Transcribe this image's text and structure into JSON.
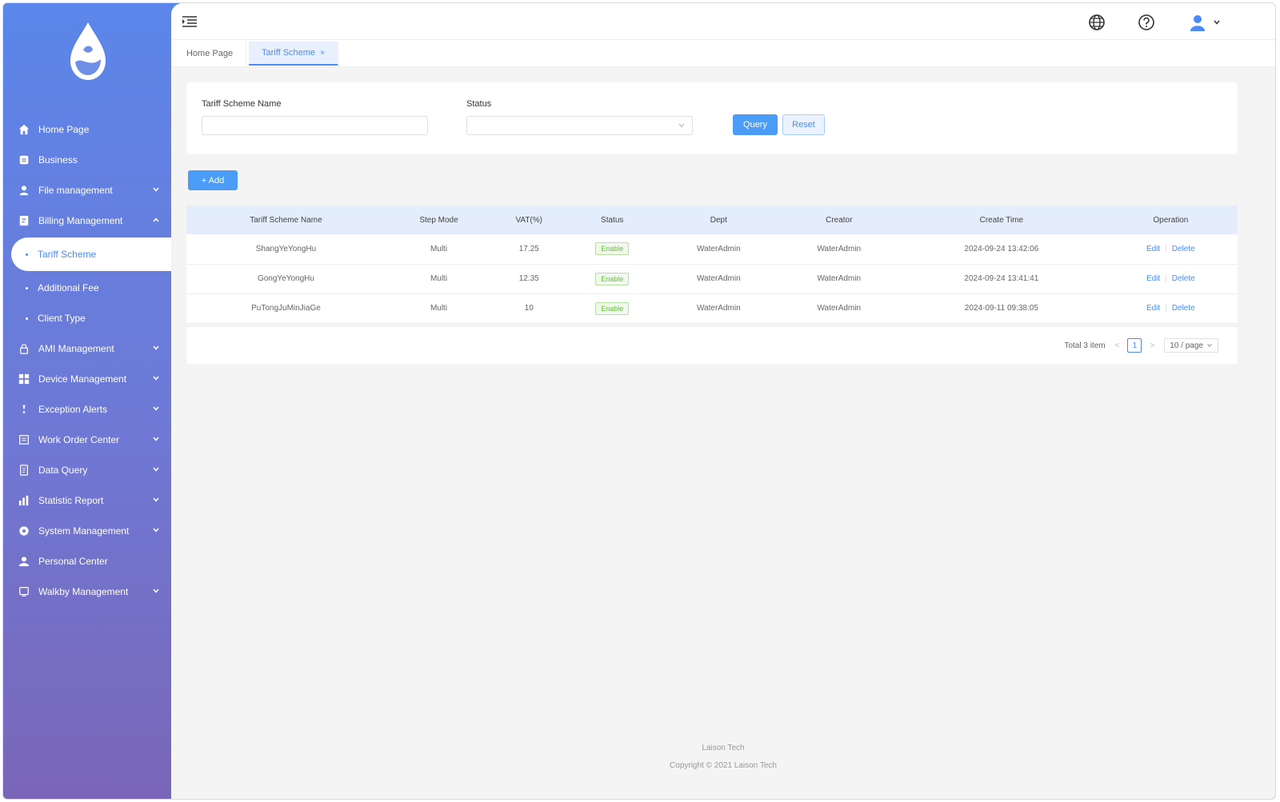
{
  "sidebar": {
    "items": [
      {
        "label": "Home Page",
        "icon": "home-icon",
        "chevron": false
      },
      {
        "label": "Business",
        "icon": "business-icon",
        "chevron": false
      },
      {
        "label": "File management",
        "icon": "file-user-icon",
        "chevron": true
      },
      {
        "label": "Billing Management",
        "icon": "billing-icon",
        "chevron": true,
        "expanded": true
      },
      {
        "label": "Tariff Scheme",
        "sub": true,
        "active": true
      },
      {
        "label": "Additional Fee",
        "sub": true
      },
      {
        "label": "Client Type",
        "sub": true
      },
      {
        "label": "AMI Management",
        "icon": "lock-icon",
        "chevron": true
      },
      {
        "label": "Device Management",
        "icon": "grid-icon",
        "chevron": true
      },
      {
        "label": "Exception Alerts",
        "icon": "alert-icon",
        "chevron": true
      },
      {
        "label": "Work Order Center",
        "icon": "workorder-icon",
        "chevron": true
      },
      {
        "label": "Data Query",
        "icon": "document-icon",
        "chevron": true
      },
      {
        "label": "Statistic Report",
        "icon": "bar-chart-icon",
        "chevron": true
      },
      {
        "label": "System Management",
        "icon": "gear-icon",
        "chevron": true
      },
      {
        "label": "Personal Center",
        "icon": "user-icon",
        "chevron": false
      },
      {
        "label": "Walkby Management",
        "icon": "walkby-icon",
        "chevron": true
      }
    ]
  },
  "tabs": [
    {
      "label": "Home Page",
      "active": false
    },
    {
      "label": "Tariff Scheme",
      "active": true,
      "close": "×"
    }
  ],
  "search": {
    "name_label": "Tariff Scheme Name",
    "name_value": "",
    "status_label": "Status",
    "status_value": "",
    "query_label": "Query",
    "reset_label": "Reset"
  },
  "add_label": "+ Add",
  "table": {
    "columns": [
      "Tariff Scheme Name",
      "Step Mode",
      "VAT(%)",
      "Status",
      "Dept",
      "Creator",
      "Create Time",
      "Operation"
    ],
    "rows": [
      {
        "name": "ShangYeYongHu",
        "step": "Multi",
        "vat": "17.25",
        "status": "Enable",
        "dept": "WaterAdmin",
        "creator": "WaterAdmin",
        "time": "2024-09-24 13:42:06",
        "edit": "Edit",
        "delete": "Delete"
      },
      {
        "name": "GongYeYongHu",
        "step": "Multi",
        "vat": "12.35",
        "status": "Enable",
        "dept": "WaterAdmin",
        "creator": "WaterAdmin",
        "time": "2024-09-24 13:41:41",
        "edit": "Edit",
        "delete": "Delete"
      },
      {
        "name": "PuTongJuMinJiaGe",
        "step": "Multi",
        "vat": "10",
        "status": "Enable",
        "dept": "WaterAdmin",
        "creator": "WaterAdmin",
        "time": "2024-09-11 09:38:05",
        "edit": "Edit",
        "delete": "Delete"
      }
    ]
  },
  "pager": {
    "total": "Total 3 item",
    "prev": "<",
    "page": "1",
    "next": ">",
    "size": "10 / page"
  },
  "footer": {
    "company": "Laison Tech",
    "copyright": "Copyright © 2021 Laison Tech"
  },
  "colors": {
    "accent": "#4a8cf7",
    "sidebar_top": "#5b86ea",
    "sidebar_bottom": "#7a66b8",
    "enable_tag": "#67c23a"
  }
}
